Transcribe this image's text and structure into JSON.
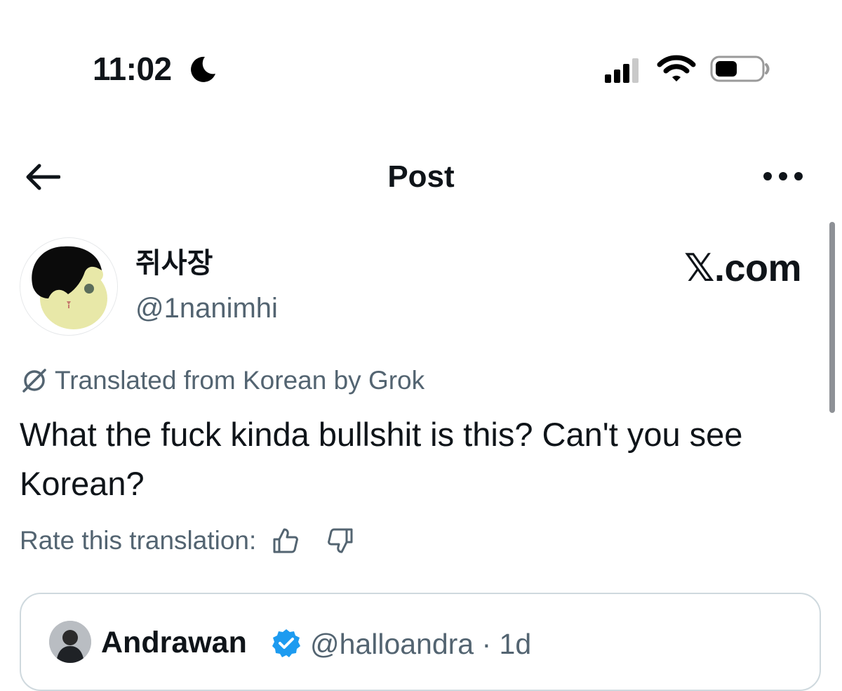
{
  "status_bar": {
    "time": "11:02",
    "icons": [
      "moon-icon",
      "signal-icon",
      "wifi-icon",
      "battery-icon"
    ]
  },
  "header": {
    "title": "Post",
    "back_icon": "arrow-left-icon",
    "more_icon": "more-horizontal-icon"
  },
  "post": {
    "author": {
      "display_name": "쥐사장",
      "handle": "@1nanimhi"
    },
    "watermark": "𝕏.com",
    "translation_notice": "Translated from Korean by Grok",
    "text": "What the fuck kinda bullshit is this? Can't you see Korean?",
    "rate_label": "Rate this translation:",
    "rate_icons": [
      "thumbs-up-icon",
      "thumbs-down-icon"
    ]
  },
  "quoted_post": {
    "display_name": "Andrawan",
    "verified": true,
    "handle_time": "@halloandra · 1d"
  },
  "colors": {
    "text_primary": "#0f1419",
    "text_secondary": "#536471",
    "verified_blue": "#1d9bf0",
    "card_border": "#cfd9de"
  }
}
